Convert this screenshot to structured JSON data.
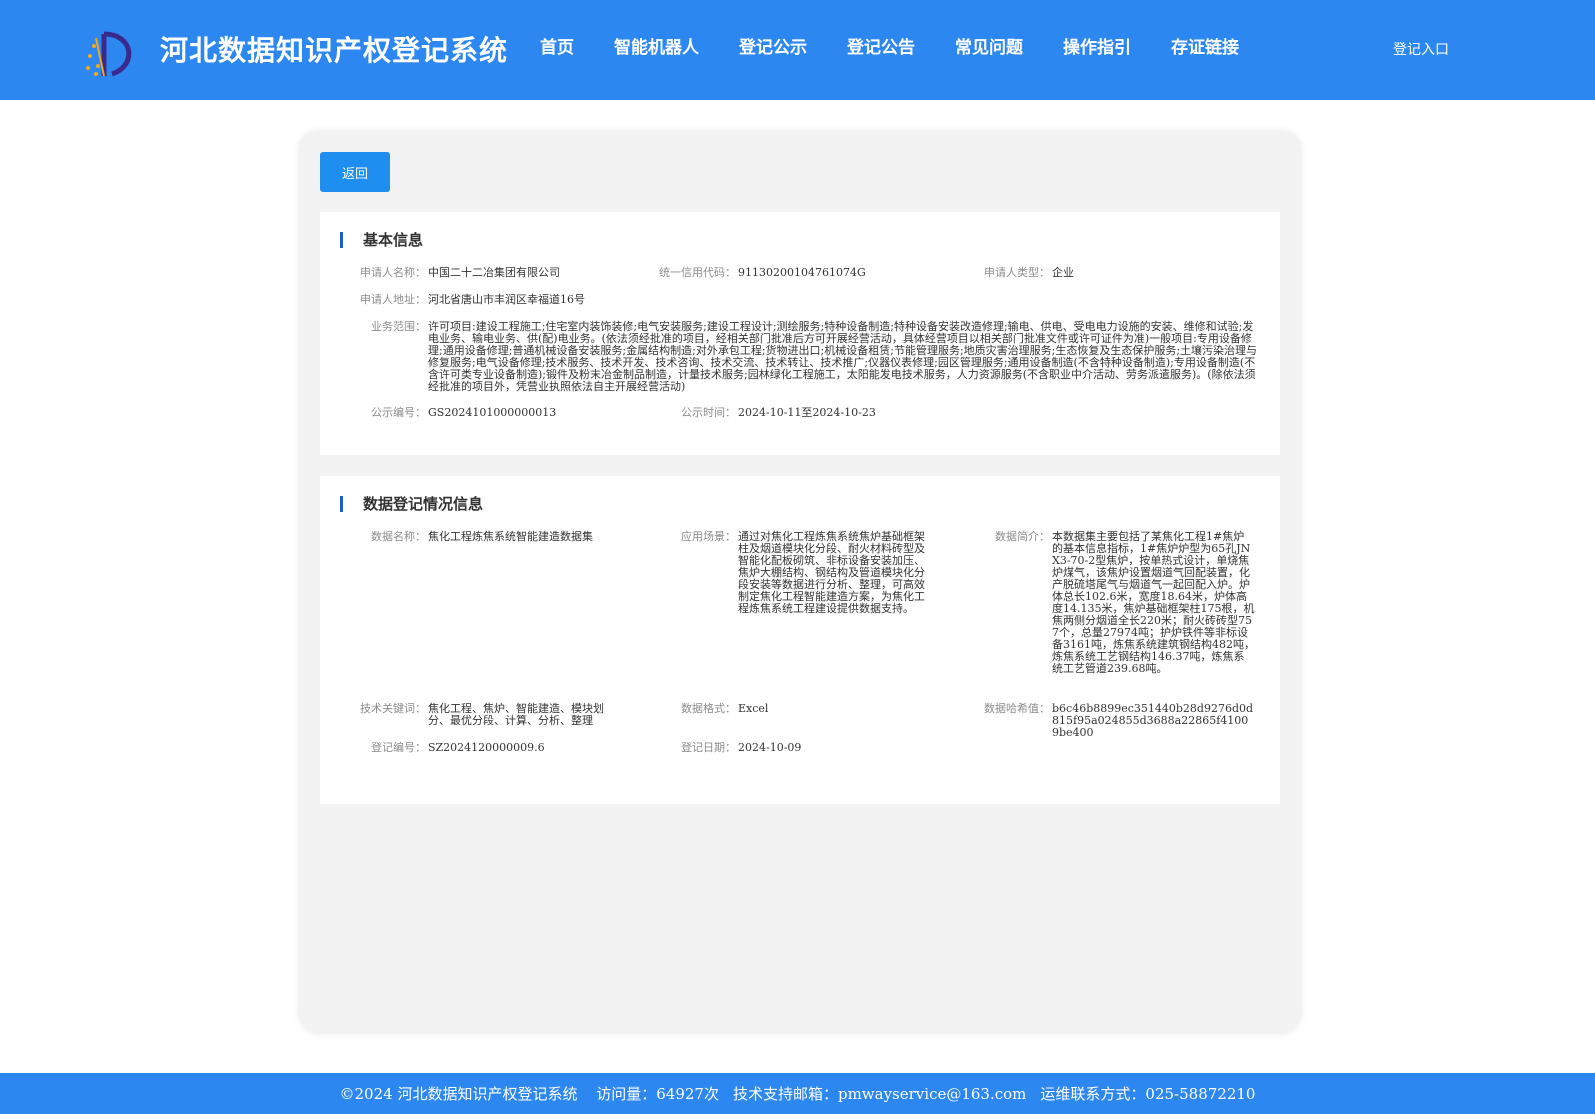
{
  "header": {
    "title": "河北数据知识产权登记系统",
    "nav": [
      "首页",
      "智能机器人",
      "登记公示",
      "登记公告",
      "常见问题",
      "操作指引",
      "存证链接"
    ],
    "login": "登记入口"
  },
  "back_label": "返回",
  "basic": {
    "title": "基本信息",
    "applicant_name_label": "申请人名称：",
    "applicant_name": "中国二十二冶集团有限公司",
    "credit_code_label": "统一信用代码：",
    "credit_code": "91130200104761074G",
    "applicant_type_label": "申请人类型：",
    "applicant_type": "企业",
    "address_label": "申请人地址：",
    "address": "河北省唐山市丰润区幸福道16号",
    "scope_label": "业务范围：",
    "scope": "许可项目:建设工程施工;住宅室内装饰装修;电气安装服务;建设工程设计;测绘服务;特种设备制造;特种设备安装改造修理;输电、供电、受电电力设施的安装、维修和试验;发电业务、输电业务、供(配)电业务。(依法须经批准的项目，经相关部门批准后方可开展经营活动，具体经营项目以相关部门批准文件或许可证件为准)一般项目:专用设备修理;通用设备修理;普通机械设备安装服务;金属结构制造;对外承包工程;货物进出口;机械设备租赁;节能管理服务;地质灾害治理服务;生态恢复及生态保护服务;土壤污染治理与修复服务;电气设备修理;技术服务、技术开发、技术咨询、技术交流、技术转让、技术推广;仪器仪表修理;园区管理服务;通用设备制造(不含特种设备制造);专用设备制造(不含许可类专业设备制造);锻件及粉末冶金制品制造，计量技术服务;园林绿化工程施工，太阳能发电技术服务，人力资源服务(不含职业中介活动、劳务派遣服务)。(除依法须经批准的项目外，凭营业执照依法自主开展经营活动)",
    "notice_no_label": "公示编号：",
    "notice_no": "GS2024101000000013",
    "notice_time_label": "公示时间：",
    "notice_time": "2024-10-11至2024-10-23"
  },
  "data_reg": {
    "title": "数据登记情况信息",
    "name_label": "数据名称：",
    "name": "焦化工程炼焦系统智能建造数据集",
    "scene_label": "应用场景：",
    "scene": "通过对焦化工程炼焦系统焦炉基础框架柱及烟道模块化分段、耐火材料砖型及智能化配板砌筑、非标设备安装加压、焦炉大棚结构、钢结构及管道模块化分段安装等数据进行分析、整理，可高效制定焦化工程智能建造方案，为焦化工程炼焦系统工程建设提供数据支持。",
    "intro_label": "数据简介：",
    "intro": "本数据集主要包括了某焦化工程1#焦炉的基本信息指标，1#焦炉炉型为65孔JNX3-70-2型焦炉，按单热式设计，单烧焦炉煤气，该焦炉设置烟道气回配装置，化产脱硫塔尾气与烟道气一起回配入炉。炉体总长102.6米，宽度18.64米，炉体高度14.135米，焦炉基础框架柱175根，机焦两侧分烟道全长220米；耐火砖砖型757个，总量27974吨；护炉铁件等非标设备3161吨，炼焦系统建筑钢结构482吨，炼焦系统工艺钢结构146.37吨，炼焦系统工艺管道239.68吨。",
    "keywords_label": "技术关键词：",
    "keywords": "焦化工程、焦炉、智能建造、模块划分、最优分段、计算、分析、整理",
    "format_label": "数据格式：",
    "format": "Excel",
    "hash_label": "数据哈希值：",
    "hash": "b6c46b8899ec351440b28d9276d0d815f95a024855d3688a22865f41009be400",
    "reg_no_label": "登记编号：",
    "reg_no": "SZ2024120000009.6",
    "reg_date_label": "登记日期：",
    "reg_date": "2024-10-09"
  },
  "footer": {
    "copyright": "©2024 河北数据知识产权登记系统",
    "visits": "访问量：64927次",
    "email": "技术支持邮箱：pmwayservice@163.com",
    "contact": "运维联系方式：025-58872210"
  },
  "colors": {
    "brand_blue": "#2d87f0",
    "button_blue": "#1e8ef1"
  },
  "icons": {
    "logo": "logo-icon"
  }
}
